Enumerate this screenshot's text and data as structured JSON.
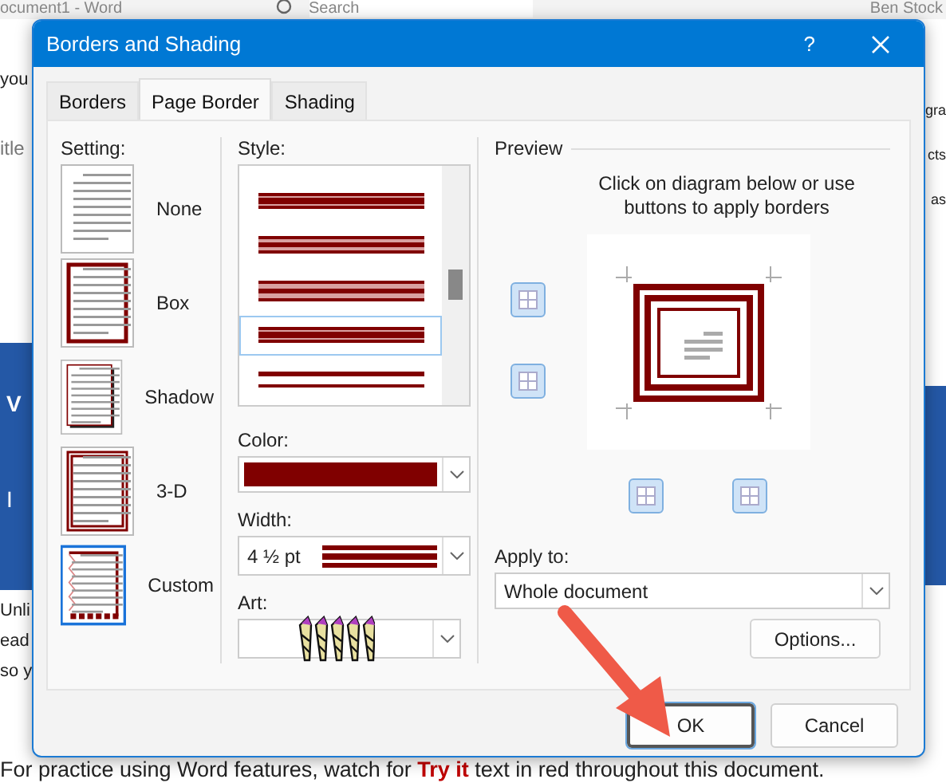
{
  "background": {
    "title": "ocument1 - Word",
    "search": "Search",
    "user": "Ben Stock",
    "left_top": [
      "you",
      "itle"
    ],
    "left_banner": [
      "V",
      "I"
    ],
    "left_bottom": [
      "Unli",
      "ead",
      "so y"
    ],
    "right_top": [
      "gra",
      "cts",
      "as"
    ],
    "footer": "For practice using Word features, watch for **Try it** text in red throughout this document."
  },
  "dialog": {
    "title": "Borders and Shading",
    "help": "?",
    "tabs": [
      {
        "label": "Borders",
        "selected": false
      },
      {
        "label": "Page Border",
        "selected": true
      },
      {
        "label": "Shading",
        "selected": false
      }
    ],
    "setting": {
      "label": "Setting:",
      "items": [
        {
          "kind": "none",
          "label": "None",
          "selected": false
        },
        {
          "kind": "box",
          "label": "Box",
          "selected": false
        },
        {
          "kind": "shadow",
          "label": "Shadow",
          "selected": false
        },
        {
          "kind": "threed",
          "label": "3-D",
          "selected": false
        },
        {
          "kind": "custom",
          "label": "Custom",
          "selected": true
        }
      ]
    },
    "style": {
      "label": "Style:",
      "items": [
        {
          "kind": "thick-triple",
          "selected": false
        },
        {
          "kind": "triple",
          "selected": false
        },
        {
          "kind": "wide-triple",
          "selected": false
        },
        {
          "kind": "thick-triple",
          "selected": true
        },
        {
          "kind": "double",
          "selected": false
        }
      ]
    },
    "color": {
      "label": "Color:",
      "color": "#800000"
    },
    "width": {
      "label": "Width:",
      "value": "4 ½ pt"
    },
    "art": {
      "label": "Art:"
    },
    "preview": {
      "label": "Preview",
      "instruction": "Click on diagram below or use buttons to apply borders"
    },
    "apply_to": {
      "label": "Apply to:",
      "value": "Whole document"
    },
    "options": "Options...",
    "buttons": [
      {
        "label": "OK",
        "focused": true
      },
      {
        "label": "Cancel",
        "focused": false
      }
    ]
  }
}
